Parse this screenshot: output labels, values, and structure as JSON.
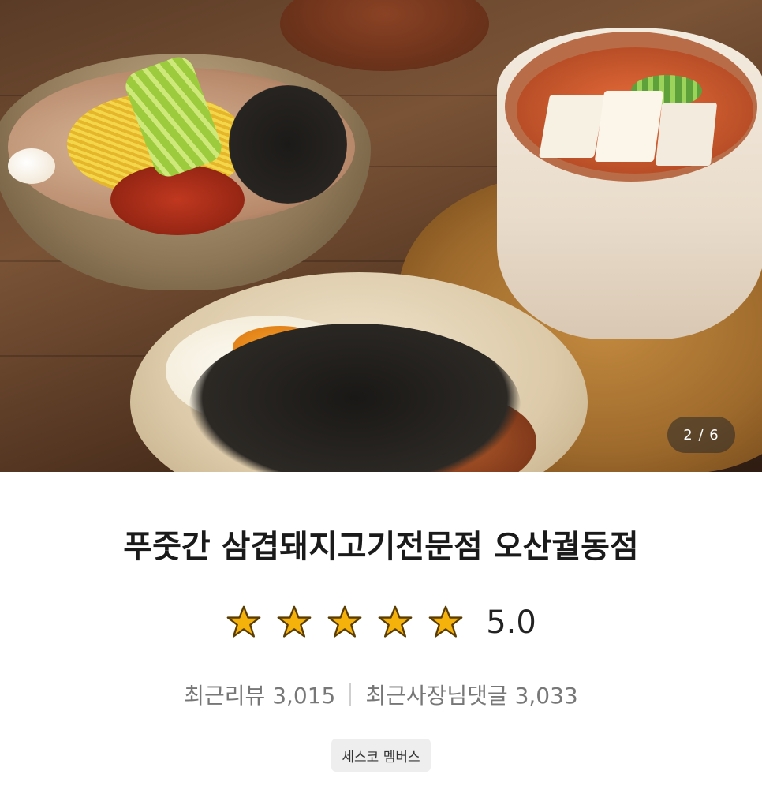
{
  "gallery": {
    "current": 2,
    "total": 6,
    "counter_text": "2 / 6",
    "image_alt": "Korean food dishes: cold noodles, soft tofu stew, seaweed rice bowl"
  },
  "store": {
    "name": "푸줏간 삼겹돼지고기전문점 오산궐동점",
    "rating_value": 5.0,
    "rating_text": "5.0",
    "star_count": 5,
    "recent_reviews_label": "최근리뷰 3,015",
    "recent_owner_replies_label": "최근사장님댓글 3,033",
    "member_badge": "세스코 멤버스"
  },
  "icons": {
    "star": "star-icon"
  },
  "colors": {
    "star_fill": "#f5b20a",
    "star_stroke": "#5a3c00",
    "title_text": "#1a1a1a",
    "stats_text": "#777777",
    "badge_bg": "#eeeeee"
  }
}
